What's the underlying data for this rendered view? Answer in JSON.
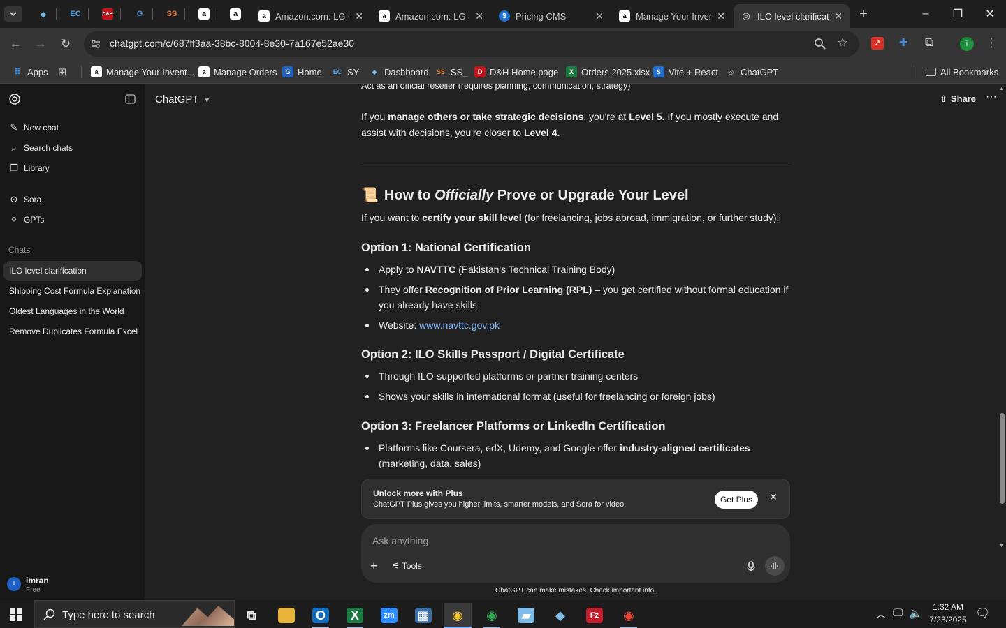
{
  "tabs": {
    "pinned": [
      {
        "name": "tab-pinned-1",
        "glyph": "◆",
        "bg": "#1f1f1f",
        "color": "#7fbde8"
      },
      {
        "name": "tab-pinned-2",
        "glyph": "EC",
        "bg": "#1f1f1f",
        "color": "#4aa3e8"
      },
      {
        "name": "tab-pinned-3",
        "glyph": "D&H",
        "bg": "#c4141b",
        "color": "#ffffff"
      },
      {
        "name": "tab-pinned-4",
        "glyph": "G",
        "bg": "#1f1f1f",
        "color": "#4a90e2"
      },
      {
        "name": "tab-pinned-5",
        "glyph": "SS",
        "bg": "#1f1f1f",
        "color": "#e07b39"
      },
      {
        "name": "tab-pinned-6",
        "glyph": "a",
        "bg": "#ffffff",
        "color": "#111111"
      },
      {
        "name": "tab-pinned-7",
        "glyph": "a",
        "bg": "#ffffff",
        "color": "#111111"
      }
    ],
    "items": [
      {
        "title": "Amazon.com: LG C",
        "glyph": "a"
      },
      {
        "title": "Amazon.com: LG 8",
        "glyph": "a"
      },
      {
        "title": "Pricing CMS",
        "glyph": "$"
      },
      {
        "title": "Manage Your Inver",
        "glyph": "a"
      },
      {
        "title": "ILO level clarificatic",
        "glyph": "◎"
      }
    ],
    "new_tab": "+"
  },
  "window": {
    "minimize": "–",
    "maximize": "❐",
    "close": "✕"
  },
  "address": {
    "url": "chatgpt.com/c/687ff3aa-38bc-8004-8e30-7a167e52ae30"
  },
  "bookmarks": {
    "apps": "Apps",
    "items": [
      {
        "label": "Manage Your Invent...",
        "glyph": "a",
        "bg": "#ffffff",
        "color": "#111"
      },
      {
        "label": "Manage Orders",
        "glyph": "a",
        "bg": "#ffffff",
        "color": "#111"
      },
      {
        "label": "Home",
        "glyph": "G",
        "bg": "#1f5fbf",
        "color": "#fff"
      },
      {
        "label": "SY",
        "glyph": "EC",
        "bg": "#353535",
        "color": "#4aa3e8"
      },
      {
        "label": "Dashboard",
        "glyph": "◆",
        "bg": "#353535",
        "color": "#7fbde8"
      },
      {
        "label": "SS_",
        "glyph": "SS",
        "bg": "#353535",
        "color": "#e07b39"
      },
      {
        "label": "D&H Home page",
        "glyph": "D",
        "bg": "#c4141b",
        "color": "#fff"
      },
      {
        "label": "Orders 2025.xlsx",
        "glyph": "X",
        "bg": "#1d7a43",
        "color": "#fff"
      },
      {
        "label": "Vite + React",
        "glyph": "$",
        "bg": "#1f6fd1",
        "color": "#fff"
      },
      {
        "label": "ChatGPT",
        "glyph": "◎",
        "bg": "#353535",
        "color": "#ccc"
      }
    ],
    "all": "All Bookmarks"
  },
  "sidebar": {
    "new_chat": "New chat",
    "search": "Search chats",
    "library": "Library",
    "sora": "Sora",
    "gpts": "GPTs",
    "chats_heading": "Chats",
    "chats": [
      "ILO level clarification",
      "Shipping Cost Formula Explanation",
      "Oldest Languages in the World",
      "Remove Duplicates Formula Excel"
    ],
    "user": {
      "initial": "I",
      "name": "imran",
      "plan": "Free"
    }
  },
  "header": {
    "model": "ChatGPT",
    "share": "Share"
  },
  "message": {
    "cut_line": "Act as an official reseller (requires planning, communication, strategy)",
    "level_p": {
      "t1": "If you ",
      "b1": "manage others or take strategic decisions",
      "t2": ", you're at ",
      "b2": "Level 5.",
      "t3": " If you mostly execute and assist with decisions, you're closer to ",
      "b3": "Level 4."
    },
    "heading": {
      "emoji": "📜",
      "pre": "How to ",
      "em": "Officially",
      "post": " Prove or Upgrade Your Level"
    },
    "intro": {
      "t1": "If you want to ",
      "b1": "certify your skill level",
      "t2": " (for freelancing, jobs abroad, immigration, or further study):"
    },
    "opt1": {
      "title_pre": "Option 1: ",
      "title_b": "National Certification",
      "b1_pre": "Apply to ",
      "b1_b": "NAVTTC",
      "b1_post": " (Pakistan's Technical Training Body)",
      "b2_pre": "They offer ",
      "b2_b": "Recognition of Prior Learning (RPL)",
      "b2_post": " – you get certified without formal education if you already have skills",
      "b3_pre": "Website: ",
      "b3_link": "www.navttc.gov.pk"
    },
    "opt2": {
      "title_pre": "Option 2: ",
      "title_b": "ILO Skills Passport / Digital Certificate",
      "b1": "Through ILO-supported platforms or partner training centers",
      "b2": "Shows your skills in international format (useful for freelancing or foreign jobs)"
    },
    "opt3": {
      "title_pre": "Option 3: ",
      "title_b": "Freelancer Platforms or LinkedIn Certification",
      "b1_pre": "Platforms like Coursera, edX, Udemy, and Google offer ",
      "b1_b": "industry-aligned certificates",
      "b1_post": " (marketing, data, sales)"
    }
  },
  "upsell": {
    "title": "Unlock more with Plus",
    "body": "ChatGPT Plus gives you higher limits, smarter models, and Sora for video.",
    "button": "Get Plus"
  },
  "composer": {
    "placeholder": "Ask anything",
    "tools": "Tools"
  },
  "disclaimer": "ChatGPT can make mistakes. Check important info.",
  "taskbar": {
    "search_placeholder": "Type here to search",
    "time": "1:32 AM",
    "date": "7/23/2025"
  },
  "colors": {
    "accent": "#7ab7ff",
    "bg": "#212121",
    "sidebar": "#181818"
  }
}
